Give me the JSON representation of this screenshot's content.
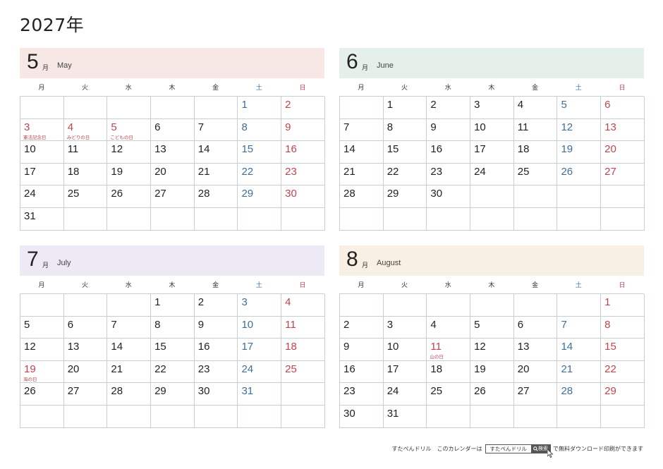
{
  "title": "2027年",
  "colors": {
    "holiday_red": "#c0444f",
    "saturday_blue": "#3f6f99",
    "grid_line": "#c9ced3"
  },
  "months": [
    {
      "number": "5",
      "kanji": "月",
      "english": "May",
      "header_color": "#f7e8e5",
      "weekdays": [
        "月",
        "火",
        "水",
        "木",
        "金",
        "土",
        "日"
      ],
      "weeks": [
        [
          {
            "d": ""
          },
          {
            "d": ""
          },
          {
            "d": ""
          },
          {
            "d": ""
          },
          {
            "d": ""
          },
          {
            "d": "1"
          },
          {
            "d": "2"
          }
        ],
        [
          {
            "d": "3",
            "holiday": "憲法記念日"
          },
          {
            "d": "4",
            "holiday": "みどりの日"
          },
          {
            "d": "5",
            "holiday": "こどもの日"
          },
          {
            "d": "6"
          },
          {
            "d": "7"
          },
          {
            "d": "8"
          },
          {
            "d": "9"
          }
        ],
        [
          {
            "d": "10"
          },
          {
            "d": "11"
          },
          {
            "d": "12"
          },
          {
            "d": "13"
          },
          {
            "d": "14"
          },
          {
            "d": "15"
          },
          {
            "d": "16"
          }
        ],
        [
          {
            "d": "17"
          },
          {
            "d": "18"
          },
          {
            "d": "19"
          },
          {
            "d": "20"
          },
          {
            "d": "21"
          },
          {
            "d": "22"
          },
          {
            "d": "23"
          }
        ],
        [
          {
            "d": "24"
          },
          {
            "d": "25"
          },
          {
            "d": "26"
          },
          {
            "d": "27"
          },
          {
            "d": "28"
          },
          {
            "d": "29"
          },
          {
            "d": "30"
          }
        ],
        [
          {
            "d": "31"
          },
          {
            "d": ""
          },
          {
            "d": ""
          },
          {
            "d": ""
          },
          {
            "d": ""
          },
          {
            "d": ""
          },
          {
            "d": ""
          }
        ]
      ]
    },
    {
      "number": "6",
      "kanji": "月",
      "english": "June",
      "header_color": "#e6f0ea",
      "weekdays": [
        "月",
        "火",
        "水",
        "木",
        "金",
        "土",
        "日"
      ],
      "weeks": [
        [
          {
            "d": ""
          },
          {
            "d": "1"
          },
          {
            "d": "2"
          },
          {
            "d": "3"
          },
          {
            "d": "4"
          },
          {
            "d": "5"
          },
          {
            "d": "6"
          }
        ],
        [
          {
            "d": "7"
          },
          {
            "d": "8"
          },
          {
            "d": "9"
          },
          {
            "d": "10"
          },
          {
            "d": "11"
          },
          {
            "d": "12"
          },
          {
            "d": "13"
          }
        ],
        [
          {
            "d": "14"
          },
          {
            "d": "15"
          },
          {
            "d": "16"
          },
          {
            "d": "17"
          },
          {
            "d": "18"
          },
          {
            "d": "19"
          },
          {
            "d": "20"
          }
        ],
        [
          {
            "d": "21"
          },
          {
            "d": "22"
          },
          {
            "d": "23"
          },
          {
            "d": "24"
          },
          {
            "d": "25"
          },
          {
            "d": "26"
          },
          {
            "d": "27"
          }
        ],
        [
          {
            "d": "28"
          },
          {
            "d": "29"
          },
          {
            "d": "30"
          },
          {
            "d": ""
          },
          {
            "d": ""
          },
          {
            "d": ""
          },
          {
            "d": ""
          }
        ],
        [
          {
            "d": ""
          },
          {
            "d": ""
          },
          {
            "d": ""
          },
          {
            "d": ""
          },
          {
            "d": ""
          },
          {
            "d": ""
          },
          {
            "d": ""
          }
        ]
      ]
    },
    {
      "number": "7",
      "kanji": "月",
      "english": "July",
      "header_color": "#ede9f5",
      "weekdays": [
        "月",
        "火",
        "水",
        "木",
        "金",
        "土",
        "日"
      ],
      "weeks": [
        [
          {
            "d": ""
          },
          {
            "d": ""
          },
          {
            "d": ""
          },
          {
            "d": "1"
          },
          {
            "d": "2"
          },
          {
            "d": "3"
          },
          {
            "d": "4"
          }
        ],
        [
          {
            "d": "5"
          },
          {
            "d": "6"
          },
          {
            "d": "7"
          },
          {
            "d": "8"
          },
          {
            "d": "9"
          },
          {
            "d": "10"
          },
          {
            "d": "11"
          }
        ],
        [
          {
            "d": "12"
          },
          {
            "d": "13"
          },
          {
            "d": "14"
          },
          {
            "d": "15"
          },
          {
            "d": "16"
          },
          {
            "d": "17"
          },
          {
            "d": "18"
          }
        ],
        [
          {
            "d": "19",
            "holiday": "海の日"
          },
          {
            "d": "20"
          },
          {
            "d": "21"
          },
          {
            "d": "22"
          },
          {
            "d": "23"
          },
          {
            "d": "24"
          },
          {
            "d": "25"
          }
        ],
        [
          {
            "d": "26"
          },
          {
            "d": "27"
          },
          {
            "d": "28"
          },
          {
            "d": "29"
          },
          {
            "d": "30"
          },
          {
            "d": "31"
          },
          {
            "d": ""
          }
        ],
        [
          {
            "d": ""
          },
          {
            "d": ""
          },
          {
            "d": ""
          },
          {
            "d": ""
          },
          {
            "d": ""
          },
          {
            "d": ""
          },
          {
            "d": ""
          }
        ]
      ]
    },
    {
      "number": "8",
      "kanji": "月",
      "english": "August",
      "header_color": "#f8f0e2",
      "weekdays": [
        "月",
        "火",
        "水",
        "木",
        "金",
        "土",
        "日"
      ],
      "weeks": [
        [
          {
            "d": ""
          },
          {
            "d": ""
          },
          {
            "d": ""
          },
          {
            "d": ""
          },
          {
            "d": ""
          },
          {
            "d": ""
          },
          {
            "d": "1"
          }
        ],
        [
          {
            "d": "2"
          },
          {
            "d": "3"
          },
          {
            "d": "4"
          },
          {
            "d": "5"
          },
          {
            "d": "6"
          },
          {
            "d": "7"
          },
          {
            "d": "8"
          }
        ],
        [
          {
            "d": "9"
          },
          {
            "d": "10"
          },
          {
            "d": "11",
            "holiday": "山の日"
          },
          {
            "d": "12"
          },
          {
            "d": "13"
          },
          {
            "d": "14"
          },
          {
            "d": "15"
          }
        ],
        [
          {
            "d": "16"
          },
          {
            "d": "17"
          },
          {
            "d": "18"
          },
          {
            "d": "19"
          },
          {
            "d": "20"
          },
          {
            "d": "21"
          },
          {
            "d": "22"
          }
        ],
        [
          {
            "d": "23"
          },
          {
            "d": "24"
          },
          {
            "d": "25"
          },
          {
            "d": "26"
          },
          {
            "d": "27"
          },
          {
            "d": "28"
          },
          {
            "d": "29"
          }
        ],
        [
          {
            "d": "30"
          },
          {
            "d": "31"
          },
          {
            "d": ""
          },
          {
            "d": ""
          },
          {
            "d": ""
          },
          {
            "d": ""
          },
          {
            "d": ""
          }
        ]
      ]
    }
  ],
  "footer": {
    "brand": "すたぺんドリル",
    "prefix": "このカレンダーは",
    "search_text": "すたぺんドリル",
    "search_button": "検索",
    "suffix": "で無料ダウンロード印刷ができます"
  }
}
